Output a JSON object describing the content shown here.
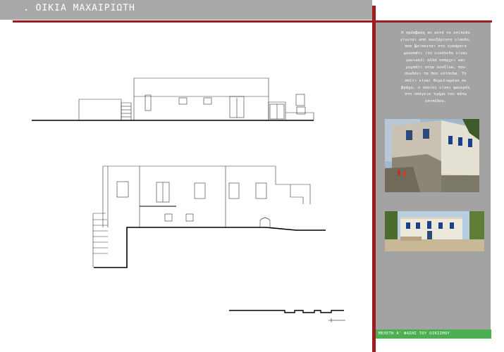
{
  "page": {
    "title": ". ΟΙΚΙΑ ΜΑΧΑΙΡΙΩΤΗ"
  },
  "sidebar": {
    "description": "Η πρόσβαση σε αυτό το επίπεδο\nγίνεται από ανεξάρτητη είσοδο,\nπου βρίσκεται στο εγκάρσιο\nμονοπάτι (το οικόπεδο είναι\nγωνιακό) αλλά υπάρχει και\nρεμπάτι στην κουζίνα, που\nσυνδέει τα δύο επίπεδα. Το\nσπίτι είναι θεμελιωμένο σε\nβράχο, ο οποίος είναι φανερός\nστο υπόγειο τμήμα του κάτω\nεπιπέδου."
  },
  "footer": {
    "label": "ΜΕΛΕΤΗ Α' ΦΑΣΗΣ ΤΟΥ ΟΙΚΙΣΜΟΥ"
  },
  "colors": {
    "header_bg": "#a9a9a9",
    "accent_red": "#9e1b20",
    "sidebar_bg": "#a3a3a3",
    "footer_green": "#4caf50"
  }
}
